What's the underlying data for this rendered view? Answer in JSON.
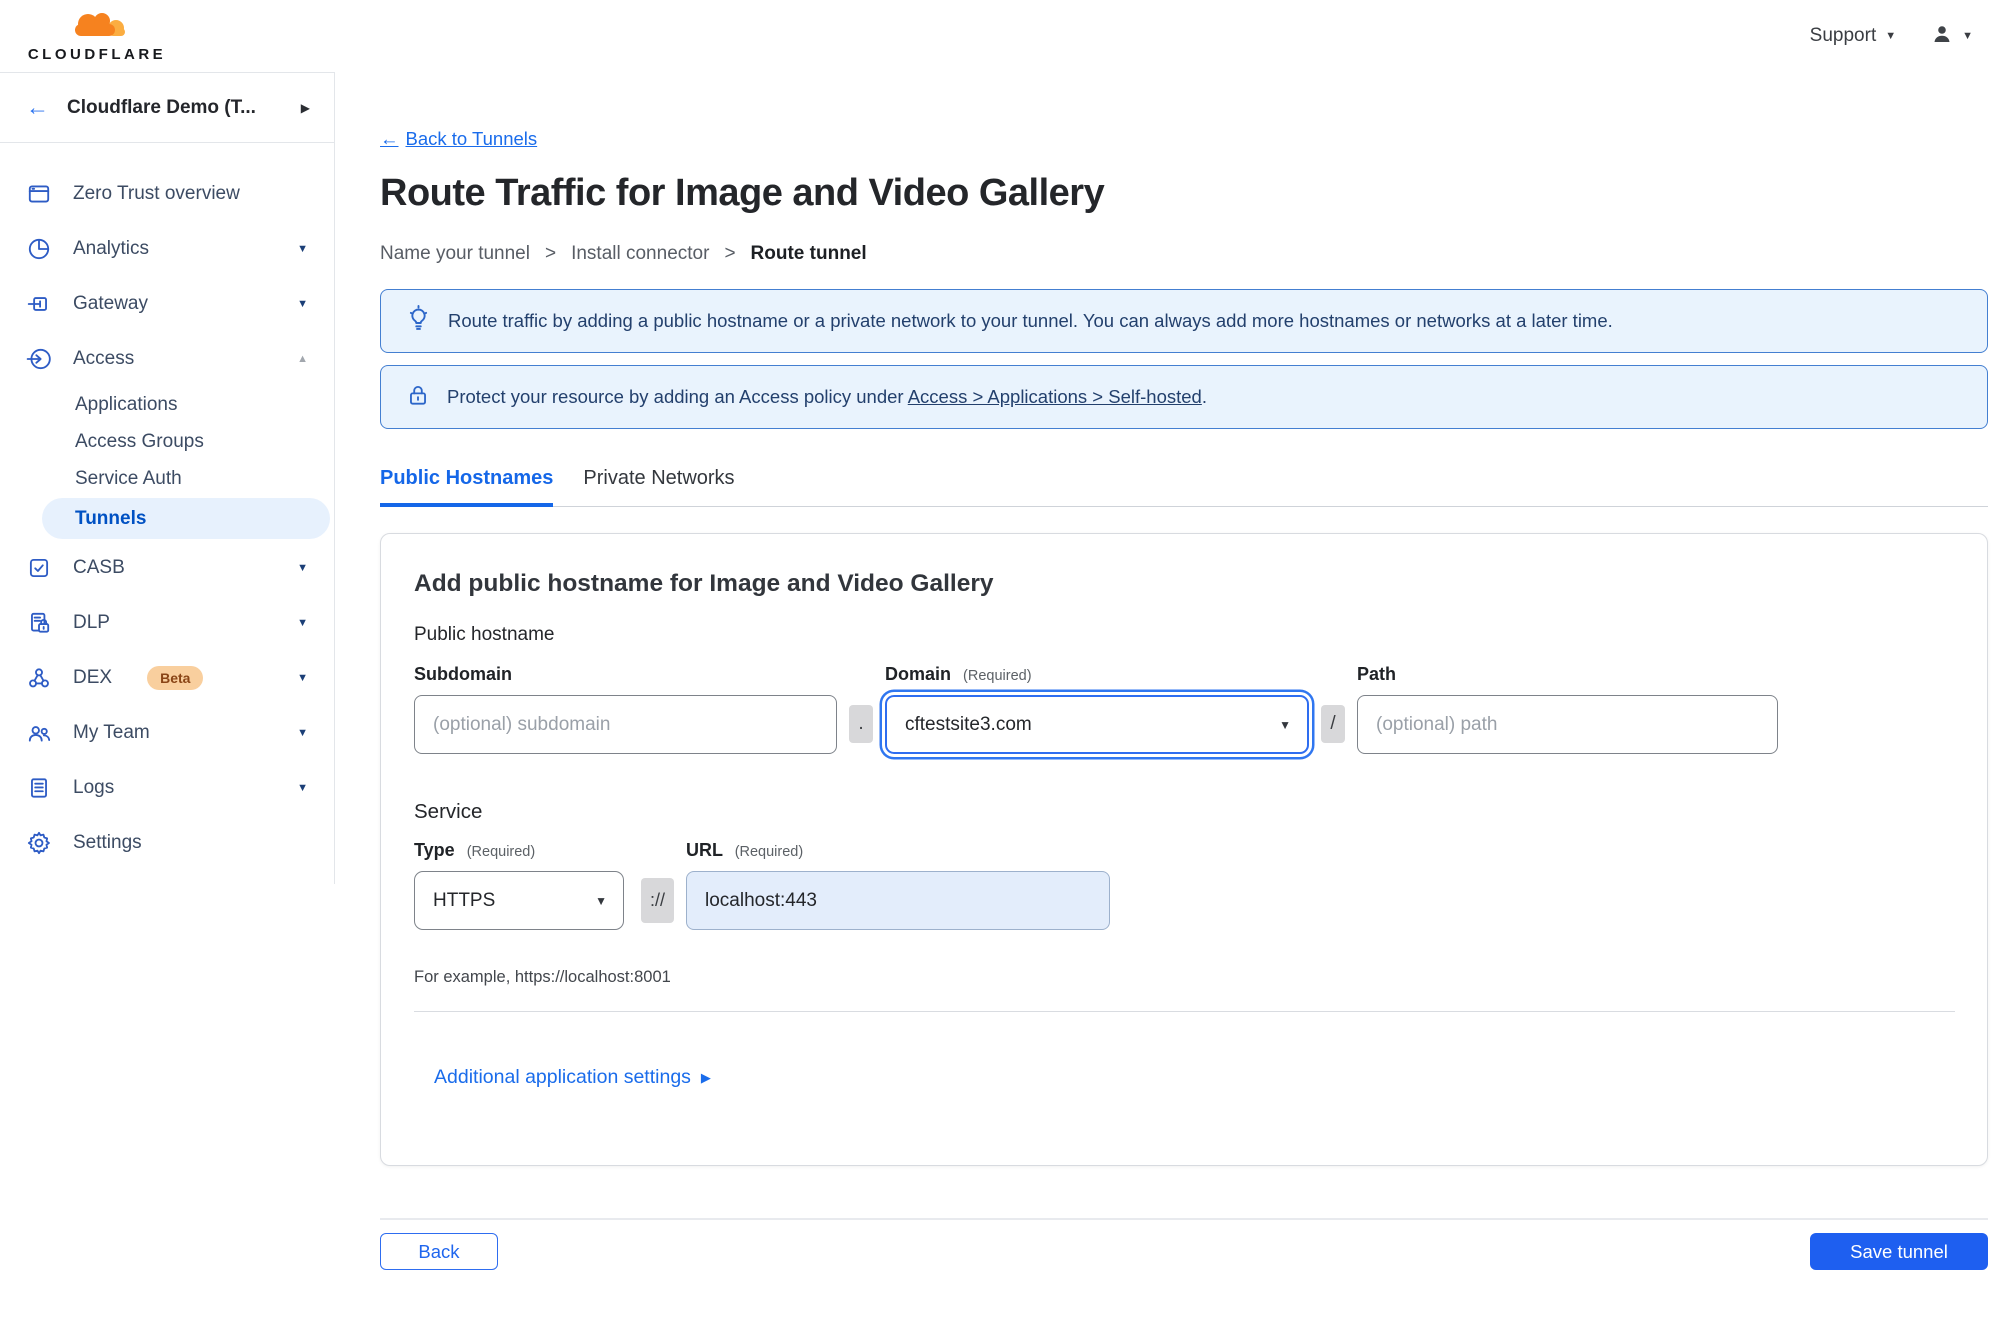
{
  "header": {
    "logo": "CLOUDFLARE",
    "support": "Support"
  },
  "sidebar": {
    "back_arrow": "←",
    "account": "Cloudflare Demo (T...",
    "items": [
      {
        "label": "Zero Trust overview",
        "icon": "overview-icon"
      },
      {
        "label": "Analytics",
        "icon": "analytics-icon",
        "caret": "down"
      },
      {
        "label": "Gateway",
        "icon": "gateway-icon",
        "caret": "down"
      },
      {
        "label": "Access",
        "icon": "access-icon",
        "caret": "up"
      },
      {
        "label": "Applications",
        "indent": true
      },
      {
        "label": "Access Groups",
        "indent": true
      },
      {
        "label": "Service Auth",
        "indent": true
      },
      {
        "label": "Tunnels",
        "indent": true,
        "active": true
      },
      {
        "label": "CASB",
        "icon": "casb-icon",
        "caret": "down"
      },
      {
        "label": "DLP",
        "icon": "dlp-icon",
        "caret": "down"
      },
      {
        "label": "DEX",
        "icon": "dex-icon",
        "caret": "down",
        "badge": "Beta"
      },
      {
        "label": "My Team",
        "icon": "team-icon",
        "caret": "down"
      },
      {
        "label": "Logs",
        "icon": "logs-icon",
        "caret": "down"
      },
      {
        "label": "Settings",
        "icon": "settings-icon"
      }
    ]
  },
  "main": {
    "back_arrow": "←",
    "back_link": "Back to Tunnels",
    "title": "Route Traffic for Image and Video Gallery",
    "steps": {
      "step1": "Name your tunnel",
      "step2": "Install connector",
      "step3": "Route tunnel",
      "separator": ">"
    },
    "banner_tip": "Route traffic by adding a public hostname or a private network to your tunnel. You can always add more hostnames or networks at a later time.",
    "banner_access_prefix": "Protect your resource by adding an Access policy under",
    "banner_access_link": "Access > Applications > Self-hosted",
    "banner_access_suffix": ".",
    "tabs": {
      "public": "Public Hostnames",
      "private": "Private Networks"
    },
    "card": {
      "title": "Add public hostname for Image and Video Gallery",
      "group_label": "Public hostname",
      "subdomain_label": "Subdomain",
      "subdomain_placeholder": "(optional) subdomain",
      "domain_label": "Domain",
      "domain_required": "(Required)",
      "domain_value": "cftestsite3.com",
      "path_label": "Path",
      "path_placeholder": "(optional) path",
      "sep_dot": ".",
      "sep_slash": "/",
      "sep_scheme": "://",
      "service_label": "Service",
      "type_label": "Type",
      "type_required": "(Required)",
      "type_value": "HTTPS",
      "url_label": "URL",
      "url_required": "(Required)",
      "url_value": "localhost:443",
      "example": "For example, https://localhost:8001",
      "additional_settings": "Additional application settings"
    },
    "footer": {
      "back": "Back",
      "save": "Save tunnel"
    }
  },
  "colors": {
    "accent_blue": "#1a66e8",
    "save_button_bg": "#1e5ff0",
    "banner_bg": "#e9f3fd",
    "banner_border": "#447fd1",
    "active_nav_bg": "#e7f1fd",
    "active_nav_text": "#0051c3",
    "beta_badge_bg": "#f9cf9e",
    "url_input_bg": "#e3edfb",
    "logo_orange": "#f6821f",
    "logo_orange_light": "#fbad41"
  }
}
